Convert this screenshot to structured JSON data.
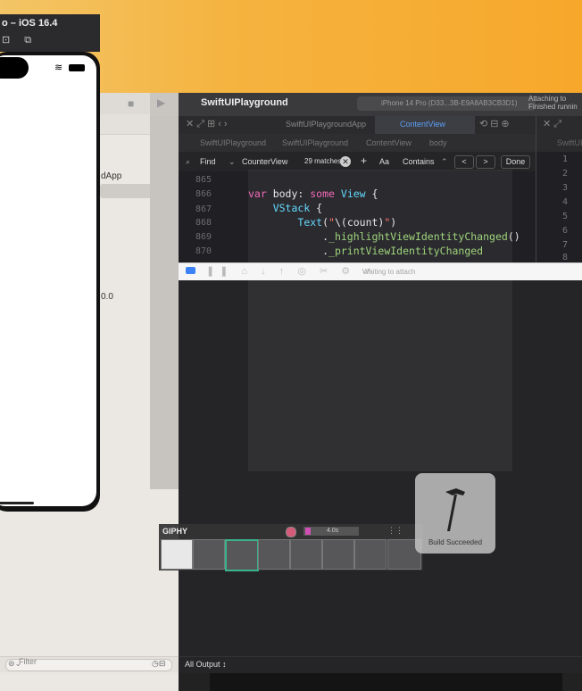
{
  "simulator": {
    "title": "o – iOS 16.4",
    "status_icons": "■ ⌁ ▬"
  },
  "xcode": {
    "window_title": "SwiftUIPlayground",
    "device": "iPhone 14 Pro (D33...3B-E9A8AB3CB3D1)",
    "status": "Attaching to\nFinished runnin",
    "tabs": [
      "SwiftUIPlaygroundApp",
      "ContentView"
    ],
    "breadcrumbs": [
      "SwiftUIPlayground",
      "SwiftUIPlayground",
      "ContentView",
      "body"
    ],
    "right_breadcrumb": "SwiftUI"
  },
  "find_bar": {
    "mode": "Find",
    "query": "CounterView",
    "matches": "29 matches",
    "plus": "+",
    "case": "Aa",
    "match_type": "Contains",
    "prev": "<",
    "next": ">",
    "done": "Done"
  },
  "code": {
    "line_numbers": [
      "865",
      "866",
      "867",
      "868",
      "869",
      "870"
    ],
    "right_line_numbers": [
      "1",
      "2",
      "3",
      "4",
      "5",
      "6",
      "7",
      "8"
    ]
  },
  "debug": {
    "status": "Waiting to attach"
  },
  "navigator": {
    "app_item": "dApp",
    "zero_value": "0.0",
    "filter_placeholder": "Filter"
  },
  "console": {
    "output_selector": "All Output ↕"
  },
  "giphy": {
    "label": "GIPHY",
    "duration": "4.0s"
  },
  "hud": {
    "message": "Build Succeeded"
  },
  "colors": {
    "keyword": "#f363b5",
    "type": "#5dd8ff",
    "string": "#fb6e62",
    "function": "#9bd274"
  }
}
